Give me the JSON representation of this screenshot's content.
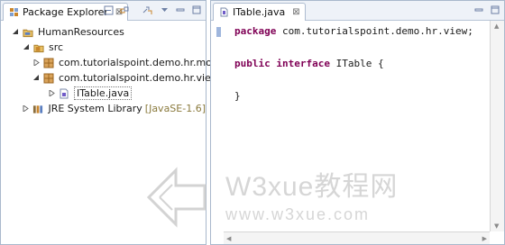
{
  "package_explorer": {
    "tab_label": "Package Explorer",
    "close_glyph": "⊠",
    "toolbar_icons": [
      "collapse-all-icon",
      "link-with-editor-icon",
      "view-menu-icon",
      "minimize-icon",
      "maximize-icon"
    ],
    "tree": [
      {
        "label": "HumanResources",
        "icon": "project-icon",
        "expanded": true,
        "depth": 0
      },
      {
        "label": "src",
        "icon": "source-folder-icon",
        "expanded": true,
        "depth": 1
      },
      {
        "label": "com.tutorialspoint.demo.hr.model",
        "icon": "package-icon",
        "expanded": false,
        "depth": 2
      },
      {
        "label": "com.tutorialspoint.demo.hr.view",
        "icon": "package-icon",
        "expanded": true,
        "depth": 2
      },
      {
        "label": "ITable.java",
        "icon": "java-interface-file-icon",
        "expanded": false,
        "depth": 3,
        "selected": true
      },
      {
        "label": "JRE System Library",
        "suffix": "[JavaSE-1.6]",
        "icon": "library-icon",
        "expanded": false,
        "depth": 1
      }
    ]
  },
  "editor": {
    "tab_label": "ITable.java",
    "close_glyph": "⊠",
    "code_lines": [
      {
        "keyword": "package",
        "rest": " com.tutorialspoint.demo.hr.view;"
      },
      {
        "keyword": "",
        "rest": ""
      },
      {
        "keyword": "public interface",
        "rest": " ITable {"
      },
      {
        "keyword": "",
        "rest": ""
      },
      {
        "keyword": "",
        "rest": "}"
      }
    ]
  },
  "watermark": {
    "line1": "W3xue教程网",
    "line2": "www.w3xue.com"
  },
  "colors": {
    "keyword": "#7f0055",
    "border": "#a9b8cc",
    "tabbar": "#eef2f8",
    "package": "#b5772d"
  }
}
